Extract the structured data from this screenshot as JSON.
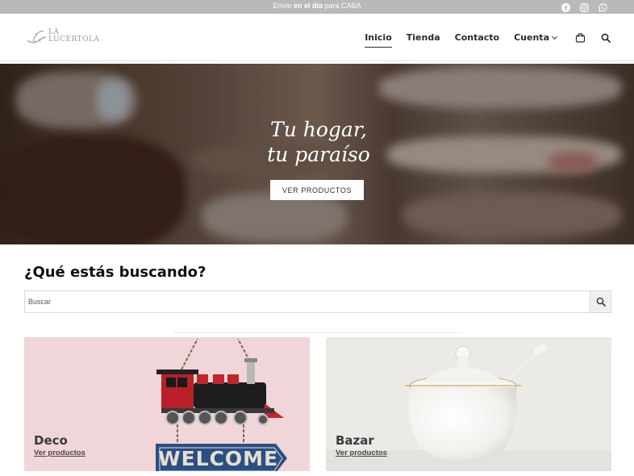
{
  "topbar": {
    "msg_prefix": "Envío ",
    "msg_bold": "en el día",
    "msg_suffix": " para CABA",
    "social_icons": [
      "facebook-icon",
      "instagram-icon",
      "whatsapp-icon"
    ]
  },
  "header": {
    "logo_line1": "LA",
    "logo_line2": "LUCERTOLA",
    "nav": [
      {
        "label": "Inicio",
        "active": true
      },
      {
        "label": "Tienda",
        "active": false
      },
      {
        "label": "Contacto",
        "active": false
      },
      {
        "label": "Cuenta",
        "active": false
      }
    ],
    "icons": [
      "cart-icon",
      "search-icon"
    ]
  },
  "hero": {
    "title_line1": "Tu hogar,",
    "title_line2": "tu paraíso",
    "button_label": "VER PRODUCTOS"
  },
  "search": {
    "title": "¿Qué estás buscando?",
    "placeholder": "Buscar"
  },
  "categories": [
    {
      "title": "Deco",
      "link": "Ver productos"
    },
    {
      "title": "Bazar",
      "link": "Ver productos"
    }
  ],
  "colors": {
    "topbar_bg": "#b9b9b9",
    "deco_bg": "#f0d6d8",
    "bazar_bg": "#eceae6",
    "text_dark": "#2b2b2b"
  }
}
